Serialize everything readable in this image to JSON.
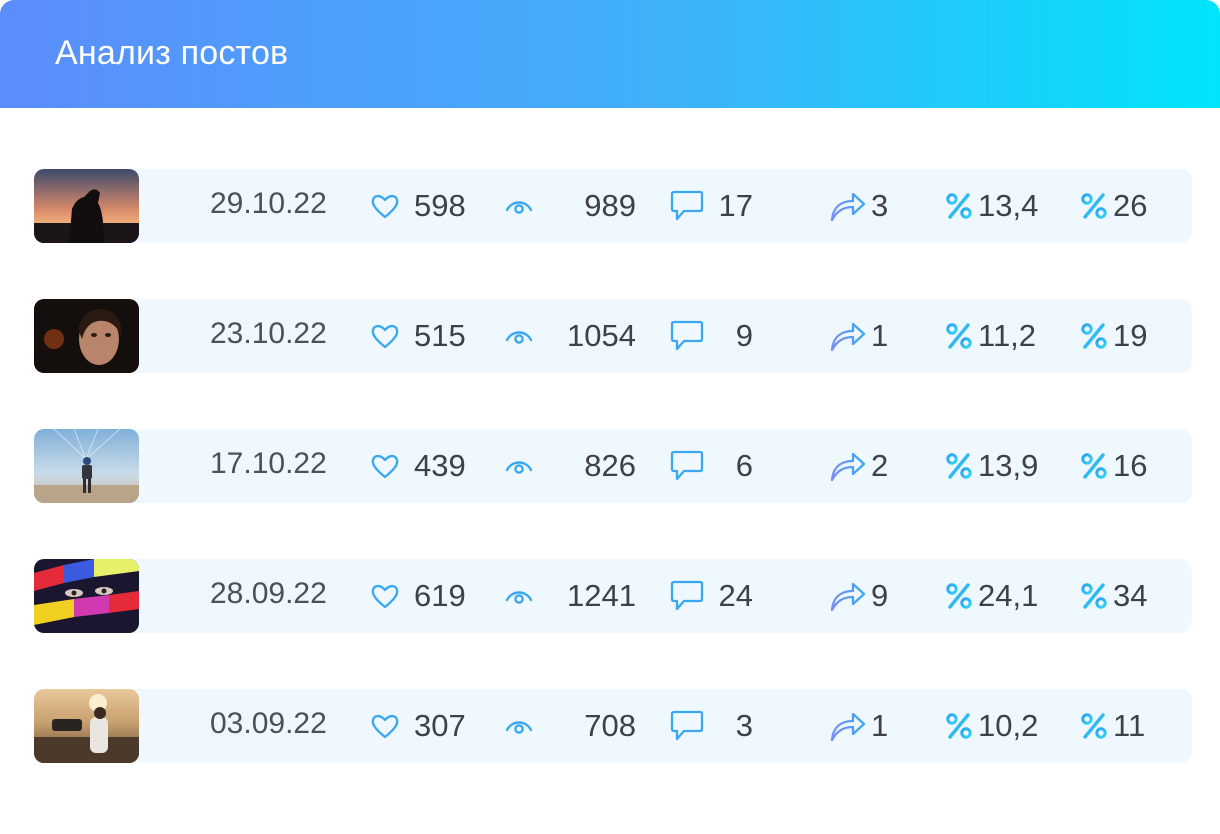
{
  "header": {
    "title": "Анализ постов"
  },
  "colors": {
    "accent": "#3fb1fb",
    "icon": "#3aa8f0",
    "row_bg": "#f0f8ff"
  },
  "icons": {
    "likes": "heart-icon",
    "views": "eye-icon",
    "comments": "comment-icon",
    "shares": "share-icon",
    "er": "percent-icon",
    "err": "percent-icon"
  },
  "posts": [
    {
      "thumb": "silhouette-sunset",
      "date": "29.10.22",
      "likes": "598",
      "views": "989",
      "comments": "17",
      "shares": "3",
      "er": "13,4",
      "err": "26"
    },
    {
      "thumb": "portrait-dark",
      "date": "23.10.22",
      "likes": "515",
      "views": "1054",
      "comments": "9",
      "shares": "1",
      "er": "11,2",
      "err": "19"
    },
    {
      "thumb": "paraglider",
      "date": "17.10.22",
      "likes": "439",
      "views": "826",
      "comments": "6",
      "shares": "2",
      "er": "13,9",
      "err": "16"
    },
    {
      "thumb": "colorful-eyes",
      "date": "28.09.22",
      "likes": "619",
      "views": "1241",
      "comments": "24",
      "shares": "9",
      "er": "24,1",
      "err": "34"
    },
    {
      "thumb": "camera-operator",
      "date": "03.09.22",
      "likes": "307",
      "views": "708",
      "comments": "3",
      "shares": "1",
      "er": "10,2",
      "err": "11"
    }
  ]
}
